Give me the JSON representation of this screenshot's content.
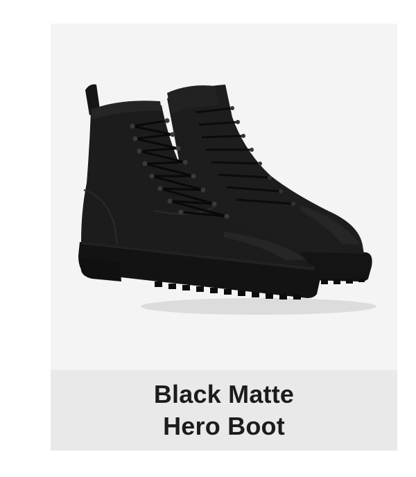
{
  "product": {
    "name_line1": "Black Matte",
    "name_line2": "Hero Boot",
    "image_icon": "boot-photo",
    "colors": {
      "card_background": "#f4f4f4",
      "caption_background": "#e9e9e9",
      "text": "#1c1c1c",
      "boot": "#1a1a1a"
    }
  }
}
